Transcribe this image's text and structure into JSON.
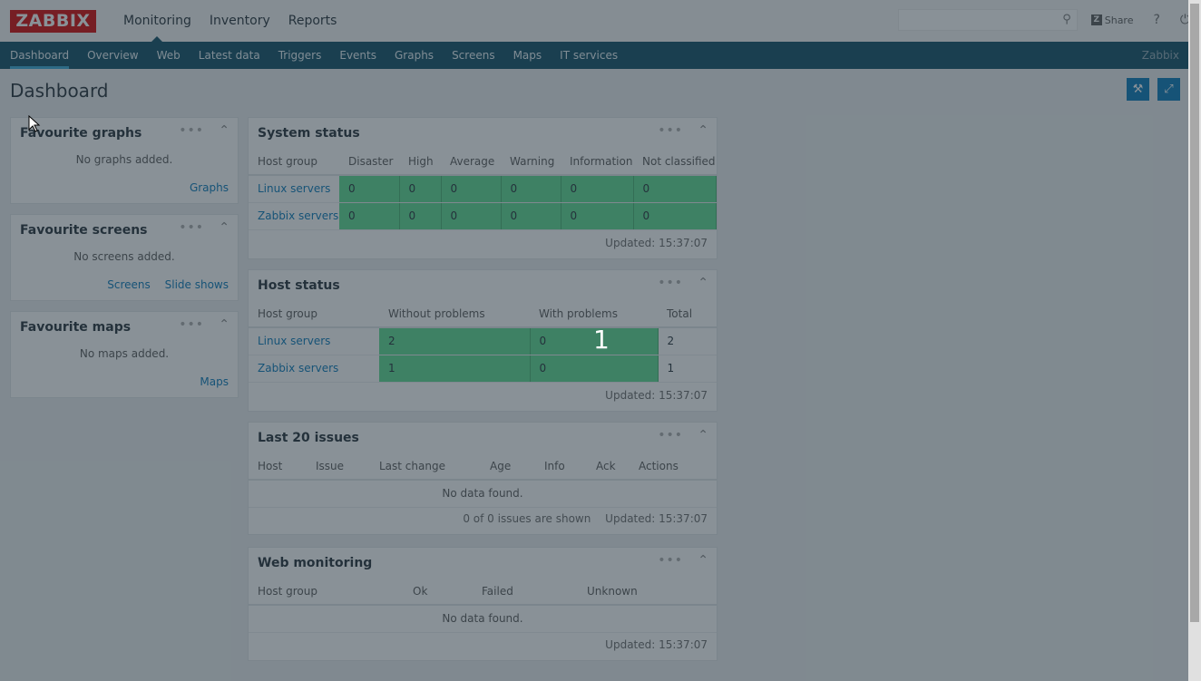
{
  "logo": "ZABBIX",
  "topmenu": [
    "Monitoring",
    "Inventory",
    "Reports"
  ],
  "share_label": "Share",
  "subnav": [
    "Dashboard",
    "Overview",
    "Web",
    "Latest data",
    "Triggers",
    "Events",
    "Graphs",
    "Screens",
    "Maps",
    "IT services"
  ],
  "brand": "Zabbix",
  "page_title": "Dashboard",
  "fav_graphs": {
    "title": "Favourite graphs",
    "empty": "No graphs added.",
    "link": "Graphs"
  },
  "fav_screens": {
    "title": "Favourite screens",
    "empty": "No screens added.",
    "link1": "Screens",
    "link2": "Slide shows"
  },
  "fav_maps": {
    "title": "Favourite maps",
    "empty": "No maps added.",
    "link": "Maps"
  },
  "system_status": {
    "title": "System status",
    "headers": [
      "Host group",
      "Disaster",
      "High",
      "Average",
      "Warning",
      "Information",
      "Not classified"
    ],
    "rows": [
      {
        "group": "Linux servers",
        "values": [
          "0",
          "0",
          "0",
          "0",
          "0",
          "0"
        ]
      },
      {
        "group": "Zabbix servers",
        "values": [
          "0",
          "0",
          "0",
          "0",
          "0",
          "0"
        ]
      }
    ],
    "updated": "Updated: 15:37:07"
  },
  "host_status": {
    "title": "Host status",
    "headers": [
      "Host group",
      "Without problems",
      "With problems",
      "Total"
    ],
    "rows": [
      {
        "group": "Linux servers",
        "without": "2",
        "with": "0",
        "total": "2"
      },
      {
        "group": "Zabbix servers",
        "without": "1",
        "with": "0",
        "total": "1"
      }
    ],
    "updated": "Updated: 15:37:07",
    "overlay_number": "1"
  },
  "last_issues": {
    "title": "Last 20 issues",
    "headers": [
      "Host",
      "Issue",
      "Last change",
      "Age",
      "Info",
      "Ack",
      "Actions"
    ],
    "empty": "No data found.",
    "shown": "0 of 0 issues are shown",
    "updated": "Updated: 15:37:07"
  },
  "web_monitoring": {
    "title": "Web monitoring",
    "headers": [
      "Host group",
      "Ok",
      "Failed",
      "Unknown"
    ],
    "empty": "No data found.",
    "updated": "Updated: 15:37:07"
  },
  "colors": {
    "ok_green": "#59db8f",
    "header_blue": "#0b4a62",
    "logo_red": "#d40000",
    "link": "#0275b8"
  }
}
